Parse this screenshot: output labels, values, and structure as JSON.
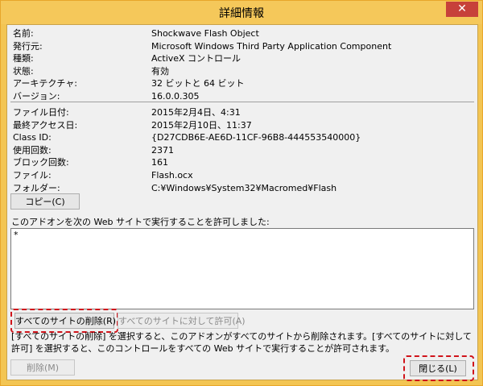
{
  "window": {
    "title": "詳細情報",
    "close_glyph": "✕"
  },
  "info": [
    {
      "key": "名前:",
      "value": "Shockwave Flash Object"
    },
    {
      "key": "発行元:",
      "value": "Microsoft Windows Third Party Application Component"
    },
    {
      "key": "種類:",
      "value": "ActiveX コントロール"
    },
    {
      "key": "状態:",
      "value": "有効"
    },
    {
      "key": "アーキテクチャ:",
      "value": "32 ビットと 64 ビット"
    },
    {
      "key": "バージョン:",
      "value": "16.0.0.305"
    }
  ],
  "details": [
    {
      "key": "ファイル日付:",
      "value": "2015年2月4日、4:31"
    },
    {
      "key": "最終アクセス日:",
      "value": "2015年2月10日、11:37"
    },
    {
      "key": "Class ID:",
      "value": "{D27CDB6E-AE6D-11CF-96B8-444553540000}"
    },
    {
      "key": "使用回数:",
      "value": "2371"
    },
    {
      "key": "ブロック回数:",
      "value": "161"
    },
    {
      "key": "ファイル:",
      "value": "Flash.ocx"
    },
    {
      "key": "フォルダー:",
      "value": "C:¥Windows¥System32¥Macromed¥Flash"
    }
  ],
  "buttons": {
    "copy": "コピー(C)",
    "remove_all_sites": "すべてのサイトの削除(R)",
    "allow_all_sites": "すべてのサイトに対して許可(A)",
    "remove": "削除(M)",
    "close": "閉じる(L)"
  },
  "sites_label": "このアドオンを次の Web サイトで実行することを許可しました:",
  "sites_entries": [
    "*"
  ],
  "description": "[すべてのサイトの削除] を選択すると、このアドオンがすべてのサイトから削除されます。[すべてのサイトに対して許可] を選択すると、このコントロールをすべての Web サイトで実行することが許可されます。",
  "colors": {
    "frame": "#f5c85a",
    "close": "#c7413a",
    "highlight": "#d0141b"
  }
}
